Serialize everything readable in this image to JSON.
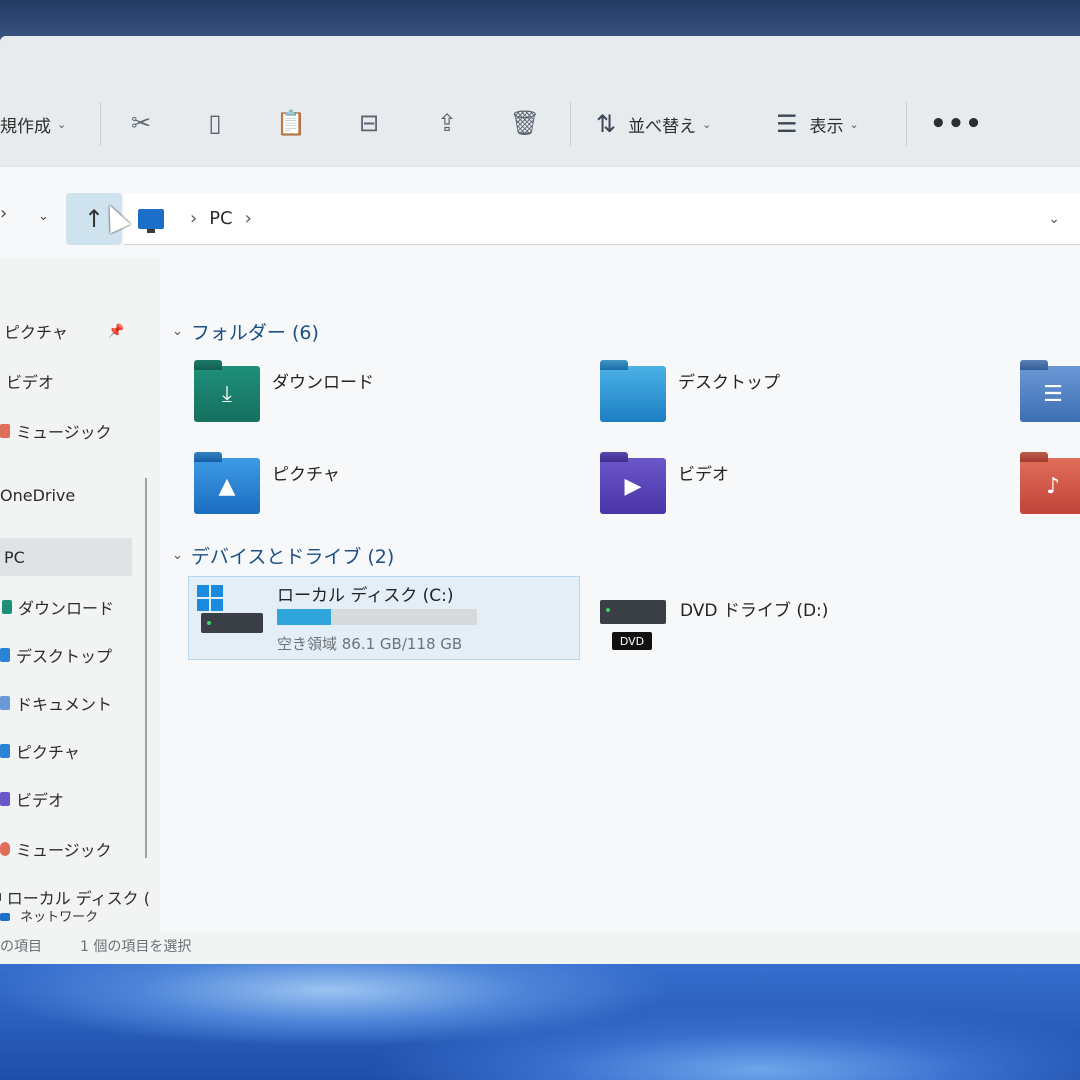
{
  "commandbar": {
    "new_label": "規作成",
    "sort_label": "並べ替え",
    "view_label": "表示",
    "more_label": "•••"
  },
  "address": {
    "crumbs": [
      "PC"
    ]
  },
  "sidebar": {
    "items": [
      {
        "label": "ピクチャ",
        "color": "#2b83d6"
      },
      {
        "label": "ビデオ",
        "color": "#6b57c9"
      },
      {
        "label": "ミュージック",
        "color": "#e06d5a"
      },
      {
        "label": "OneDrive",
        "color": "#1b6fc8"
      },
      {
        "label": "PC",
        "color": "#1b6fc8"
      },
      {
        "label": "ダウンロード",
        "color": "#1f8f7a"
      },
      {
        "label": "デスクトップ",
        "color": "#2b83d6"
      },
      {
        "label": "ドキュメント",
        "color": "#6b98d6"
      },
      {
        "label": "ピクチャ",
        "color": "#2b83d6"
      },
      {
        "label": "ビデオ",
        "color": "#6b57c9"
      },
      {
        "label": "ミュージック",
        "color": "#e06d5a"
      },
      {
        "label": "ローカル ディスク (",
        "color": "#3a3f45"
      },
      {
        "label": "ネットワーク",
        "color": "#1b6fc8"
      }
    ]
  },
  "folders": {
    "header": "フォルダー (6)",
    "items": [
      {
        "label": "ダウンロード",
        "icon": "download-folder-icon"
      },
      {
        "label": "デスクトップ",
        "icon": "desktop-folder-icon"
      },
      {
        "label": "ピクチャ",
        "icon": "pictures-folder-icon"
      },
      {
        "label": "ビデオ",
        "icon": "videos-folder-icon"
      }
    ]
  },
  "devices": {
    "header": "デバイスとドライブ (2)",
    "local": {
      "name": "ローカル ディスク (C:)",
      "free": "空き領域 86.1 GB/118 GB",
      "used_fraction": 0.27
    },
    "dvd": {
      "name": "DVD ドライブ (D:)",
      "badge": "DVD"
    }
  },
  "status": {
    "count": "の項目",
    "selected": "1 個の項目を選択"
  }
}
